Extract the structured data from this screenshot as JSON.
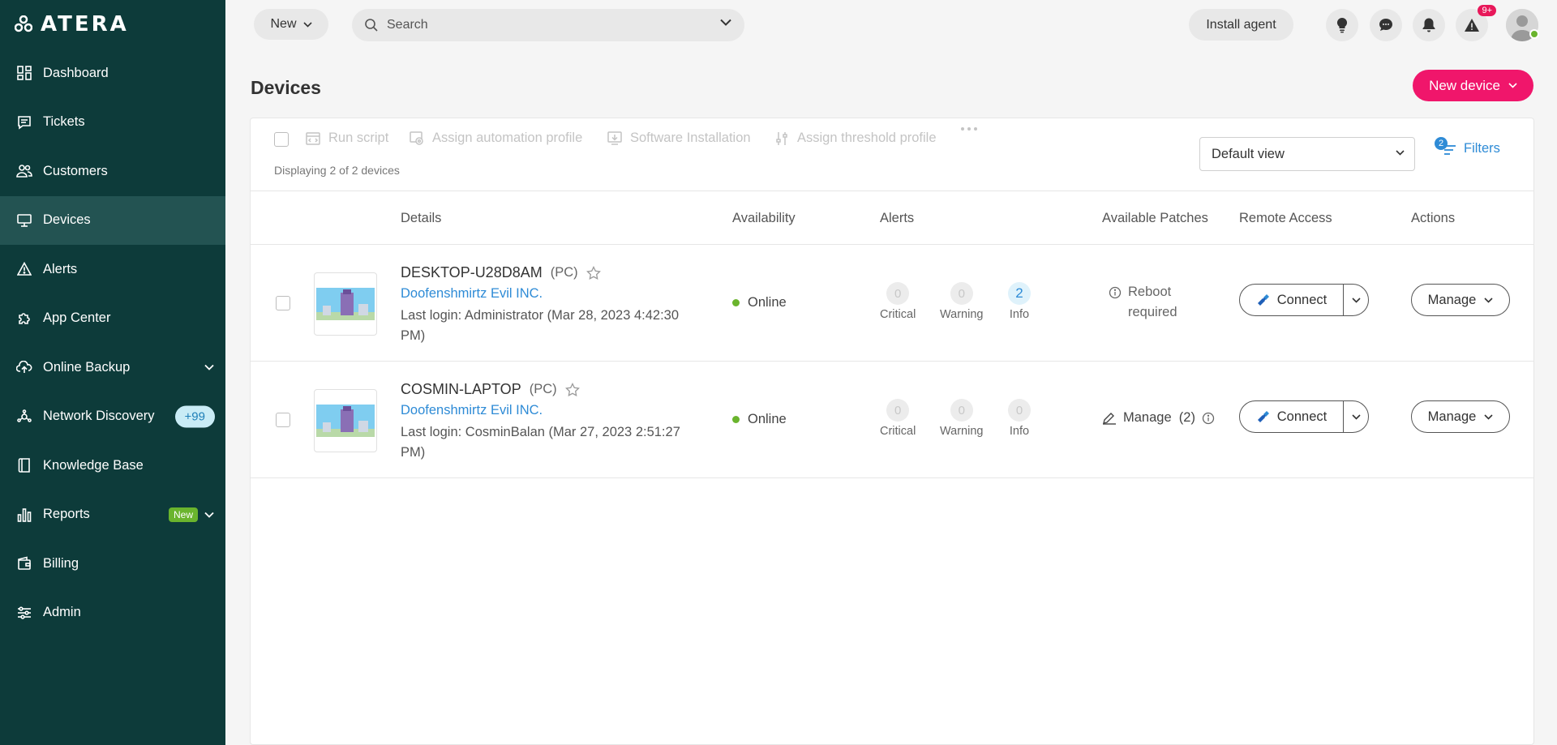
{
  "brand": {
    "name": "ATERA"
  },
  "sidebar": {
    "items": [
      {
        "label": "Dashboard",
        "icon": "dashboard-icon"
      },
      {
        "label": "Tickets",
        "icon": "ticket-icon"
      },
      {
        "label": "Customers",
        "icon": "customers-icon"
      },
      {
        "label": "Devices",
        "icon": "monitor-icon",
        "active": true
      },
      {
        "label": "Alerts",
        "icon": "alert-triangle-icon"
      },
      {
        "label": "App Center",
        "icon": "puzzle-icon"
      },
      {
        "label": "Online Backup",
        "icon": "cloud-upload-icon",
        "expandable": true
      },
      {
        "label": "Network Discovery",
        "icon": "network-icon",
        "badge": "+99"
      },
      {
        "label": "Knowledge Base",
        "icon": "book-icon"
      },
      {
        "label": "Reports",
        "icon": "bar-chart-icon",
        "badge": "New",
        "expandable": true
      },
      {
        "label": "Billing",
        "icon": "wallet-icon"
      },
      {
        "label": "Admin",
        "icon": "sliders-icon"
      }
    ]
  },
  "topbar": {
    "new_label": "New",
    "search_placeholder": "Search",
    "install_agent_label": "Install agent",
    "alerts_badge": "9+"
  },
  "page": {
    "title": "Devices",
    "new_device_label": "New device"
  },
  "toolbar": {
    "actions": [
      "Run script",
      "Assign automation profile",
      "Software Installation",
      "Assign threshold profile"
    ],
    "displaying": "Displaying 2 of 2 devices",
    "view_value": "Default view",
    "filters_label": "Filters",
    "filters_count": "2"
  },
  "table": {
    "headers": [
      "Details",
      "Availability",
      "Alerts",
      "Available Patches",
      "Remote Access",
      "Actions"
    ],
    "alert_labels": [
      "Critical",
      "Warning",
      "Info"
    ],
    "connect_label": "Connect",
    "manage_label": "Manage",
    "rows": [
      {
        "name": "DESKTOP-U28D8AM",
        "type": "(PC)",
        "customer": "Doofenshmirtz Evil INC.",
        "login": "Last login: Administrator (Mar 28, 2023 4:42:30 PM)",
        "availability": "Online",
        "critical": "0",
        "warning": "0",
        "info": "2",
        "patches": "Reboot required"
      },
      {
        "name": "COSMIN-LAPTOP",
        "type": "(PC)",
        "customer": "Doofenshmirtz Evil INC.",
        "login": "Last login: CosminBalan (Mar 27, 2023 2:51:27 PM)",
        "availability": "Online",
        "critical": "0",
        "warning": "0",
        "info": "0",
        "patches": "Manage  (2)"
      }
    ]
  },
  "colors": {
    "sidebar_bg": "#0d3b3a",
    "sidebar_active": "#235352",
    "accent_pink": "#f0166b",
    "link_blue": "#2e8bd6",
    "online_green": "#6ab42d"
  }
}
